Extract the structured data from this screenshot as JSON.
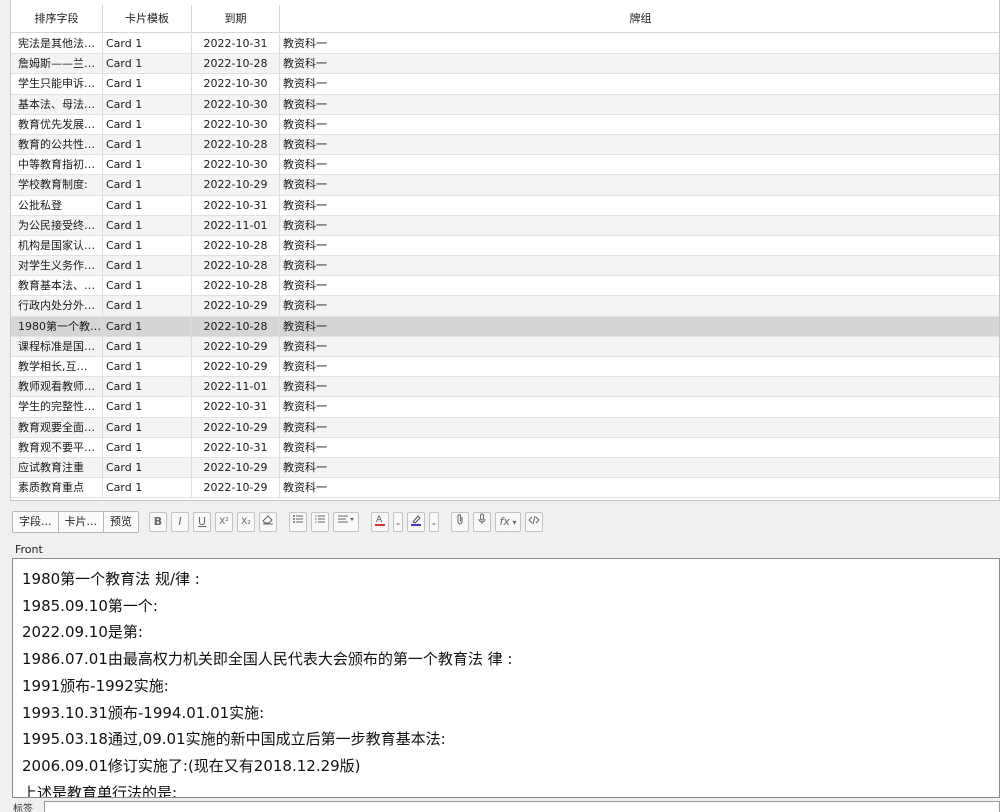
{
  "columns": [
    "排序字段",
    "卡片模板",
    "到期",
    "牌组"
  ],
  "rows": [
    {
      "sort": "宪法是其他法…",
      "template": "Card 1",
      "due": "2022-10-31",
      "deck": "教资科一"
    },
    {
      "sort": "詹姆斯——兰…",
      "template": "Card 1",
      "due": "2022-10-28",
      "deck": "教资科一"
    },
    {
      "sort": "学生只能申诉…",
      "template": "Card 1",
      "due": "2022-10-30",
      "deck": "教资科一"
    },
    {
      "sort": "基本法、母法…",
      "template": "Card 1",
      "due": "2022-10-30",
      "deck": "教资科一"
    },
    {
      "sort": "教育优先发展…",
      "template": "Card 1",
      "due": "2022-10-30",
      "deck": "教资科一"
    },
    {
      "sort": "教育的公共性…",
      "template": "Card 1",
      "due": "2022-10-28",
      "deck": "教资科一"
    },
    {
      "sort": "中等教育指初…",
      "template": "Card 1",
      "due": "2022-10-30",
      "deck": "教资科一"
    },
    {
      "sort": "学校教育制度:",
      "template": "Card 1",
      "due": "2022-10-29",
      "deck": "教资科一"
    },
    {
      "sort": "公批私登",
      "template": "Card 1",
      "due": "2022-10-31",
      "deck": "教资科一"
    },
    {
      "sort": "为公民接受终…",
      "template": "Card 1",
      "due": "2022-11-01",
      "deck": "教资科一"
    },
    {
      "sort": "机构是国家认…",
      "template": "Card 1",
      "due": "2022-10-28",
      "deck": "教资科一"
    },
    {
      "sort": "对学生义务作…",
      "template": "Card 1",
      "due": "2022-10-28",
      "deck": "教资科一"
    },
    {
      "sort": "教育基本法、…",
      "template": "Card 1",
      "due": "2022-10-28",
      "deck": "教资科一"
    },
    {
      "sort": "行政内处分外…",
      "template": "Card 1",
      "due": "2022-10-29",
      "deck": "教资科一"
    },
    {
      "sort": "1980第一个教…",
      "template": "Card 1",
      "due": "2022-10-28",
      "deck": "教资科一",
      "selected": true
    },
    {
      "sort": "课程标准是国…",
      "template": "Card 1",
      "due": "2022-10-29",
      "deck": "教资科一"
    },
    {
      "sort": "教学相长,互…",
      "template": "Card 1",
      "due": "2022-10-29",
      "deck": "教资科一"
    },
    {
      "sort": "教师观看教师…",
      "template": "Card 1",
      "due": "2022-11-01",
      "deck": "教资科一"
    },
    {
      "sort": "学生的完整性…",
      "template": "Card 1",
      "due": "2022-10-31",
      "deck": "教资科一"
    },
    {
      "sort": "教育观要全面…",
      "template": "Card 1",
      "due": "2022-10-29",
      "deck": "教资科一"
    },
    {
      "sort": "教育观不要平…",
      "template": "Card 1",
      "due": "2022-10-31",
      "deck": "教资科一"
    },
    {
      "sort": "应试教育注重",
      "template": "Card 1",
      "due": "2022-10-29",
      "deck": "教资科一"
    },
    {
      "sort": "素质教育重点",
      "template": "Card 1",
      "due": "2022-10-29",
      "deck": "教资科一"
    }
  ],
  "toolbar": {
    "fields_label": "字段...",
    "cards_label": "卡片...",
    "preview_label": "预览",
    "bold": "B",
    "italic": "I",
    "underline": "U",
    "superscript": "X²",
    "subscript": "X₂",
    "formula": "fx",
    "icons": [
      "eraser-icon",
      "bullet-list-icon",
      "numbered-list-icon",
      "align-icon",
      "text-color-icon",
      "highlight-icon",
      "attachment-icon",
      "microphone-icon",
      "formula-icon",
      "html-editor-icon"
    ],
    "text_color": "#d9342b",
    "highlight_color": "#3a3acc"
  },
  "editor": {
    "field_name": "Front",
    "lines": [
      "1980第一个教育法 规/律 :",
      "1985.09.10第一个:",
      "2022.09.10是第:",
      "1986.07.01由最高权力机关即全国人民代表大会颁布的第一个教育法 律 :",
      "1991颁布-1992实施:",
      "1993.10.31颁布-1994.01.01实施:",
      "1995.03.18通过,09.01实施的新中国成立后第一步教育基本法:",
      "2006.09.01修订实施了:(现在又有2018.12.29版)",
      "上述是教育单行法的是:"
    ]
  },
  "tags": {
    "label": "标签"
  }
}
